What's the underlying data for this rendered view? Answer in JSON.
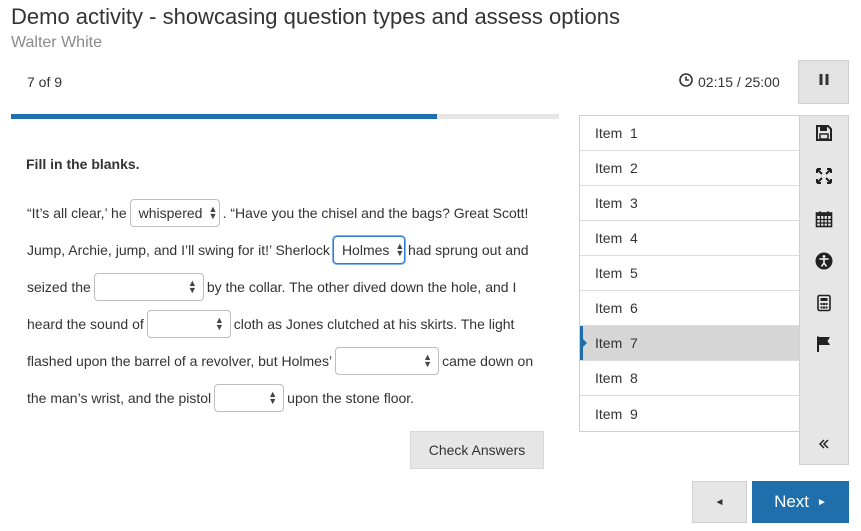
{
  "header": {
    "title": "Demo activity - showcasing question types and assess options",
    "subtitle": "Walter White"
  },
  "status": {
    "counter": "7 of 9",
    "timer": "02:15 / 25:00",
    "progress_fraction": 0.7778
  },
  "question": {
    "prompt": "Fill in the blanks.",
    "lines": [
      [
        "“It’s all clear,’ he",
        {
          "select": "whispered"
        },
        ". “Have you the chisel and the bags? Great Scott!"
      ],
      [
        "Jump, Archie, jump, and I’ll swing for it!’ Sherlock",
        {
          "select": "Holmes",
          "focused": true
        },
        "had sprung out and"
      ],
      [
        "seized the",
        {
          "select": ""
        },
        "by the collar. The other dived down the hole, and I"
      ],
      [
        "heard the sound of",
        {
          "select": ""
        },
        "cloth as Jones clutched at his skirts. The light"
      ],
      [
        "flashed upon the barrel of a revolver, but Holmes’",
        {
          "select": ""
        },
        "came down on"
      ],
      [
        "the man’s wrist, and the pistol",
        {
          "select": ""
        },
        "upon the stone floor."
      ]
    ],
    "check_button": "Check Answers"
  },
  "items": {
    "labels": [
      "Item  1",
      "Item  2",
      "Item  3",
      "Item  4",
      "Item  5",
      "Item  6",
      "Item  7",
      "Item  8",
      "Item  9"
    ],
    "active_index": 6
  },
  "toolbar": {
    "icons": [
      "save-icon",
      "fullscreen-icon",
      "calendar-icon",
      "accessibility-icon",
      "calculator-icon",
      "flag-icon",
      "collapse-icon"
    ]
  },
  "nav": {
    "prev_glyph": "◄",
    "next_label": "Next",
    "next_glyph": "►"
  },
  "colors": {
    "accent": "#1f6fad",
    "focus": "#2d7bd1"
  }
}
